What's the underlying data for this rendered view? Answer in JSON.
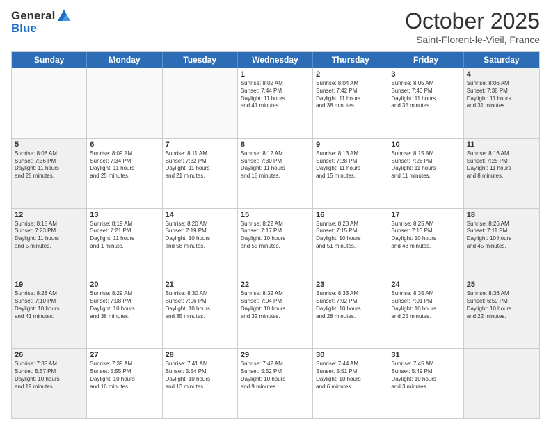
{
  "header": {
    "logo_general": "General",
    "logo_blue": "Blue",
    "month_title": "October 2025",
    "location": "Saint-Florent-le-Vieil, France"
  },
  "weekdays": [
    "Sunday",
    "Monday",
    "Tuesday",
    "Wednesday",
    "Thursday",
    "Friday",
    "Saturday"
  ],
  "rows": [
    [
      {
        "day": "",
        "text": "",
        "empty": true
      },
      {
        "day": "",
        "text": "",
        "empty": true
      },
      {
        "day": "",
        "text": "",
        "empty": true
      },
      {
        "day": "1",
        "text": "Sunrise: 8:02 AM\nSunset: 7:44 PM\nDaylight: 11 hours\nand 41 minutes.",
        "empty": false
      },
      {
        "day": "2",
        "text": "Sunrise: 8:04 AM\nSunset: 7:42 PM\nDaylight: 11 hours\nand 38 minutes.",
        "empty": false
      },
      {
        "day": "3",
        "text": "Sunrise: 8:05 AM\nSunset: 7:40 PM\nDaylight: 11 hours\nand 35 minutes.",
        "empty": false
      },
      {
        "day": "4",
        "text": "Sunrise: 8:06 AM\nSunset: 7:38 PM\nDaylight: 11 hours\nand 31 minutes.",
        "empty": false,
        "shaded": true
      }
    ],
    [
      {
        "day": "5",
        "text": "Sunrise: 8:08 AM\nSunset: 7:36 PM\nDaylight: 11 hours\nand 28 minutes.",
        "empty": false,
        "shaded": true
      },
      {
        "day": "6",
        "text": "Sunrise: 8:09 AM\nSunset: 7:34 PM\nDaylight: 11 hours\nand 25 minutes.",
        "empty": false
      },
      {
        "day": "7",
        "text": "Sunrise: 8:11 AM\nSunset: 7:32 PM\nDaylight: 11 hours\nand 21 minutes.",
        "empty": false
      },
      {
        "day": "8",
        "text": "Sunrise: 8:12 AM\nSunset: 7:30 PM\nDaylight: 11 hours\nand 18 minutes.",
        "empty": false
      },
      {
        "day": "9",
        "text": "Sunrise: 8:13 AM\nSunset: 7:28 PM\nDaylight: 11 hours\nand 15 minutes.",
        "empty": false
      },
      {
        "day": "10",
        "text": "Sunrise: 8:15 AM\nSunset: 7:26 PM\nDaylight: 11 hours\nand 11 minutes.",
        "empty": false
      },
      {
        "day": "11",
        "text": "Sunrise: 8:16 AM\nSunset: 7:25 PM\nDaylight: 11 hours\nand 8 minutes.",
        "empty": false,
        "shaded": true
      }
    ],
    [
      {
        "day": "12",
        "text": "Sunrise: 8:18 AM\nSunset: 7:23 PM\nDaylight: 11 hours\nand 5 minutes.",
        "empty": false,
        "shaded": true
      },
      {
        "day": "13",
        "text": "Sunrise: 8:19 AM\nSunset: 7:21 PM\nDaylight: 11 hours\nand 1 minute.",
        "empty": false
      },
      {
        "day": "14",
        "text": "Sunrise: 8:20 AM\nSunset: 7:19 PM\nDaylight: 10 hours\nand 58 minutes.",
        "empty": false
      },
      {
        "day": "15",
        "text": "Sunrise: 8:22 AM\nSunset: 7:17 PM\nDaylight: 10 hours\nand 55 minutes.",
        "empty": false
      },
      {
        "day": "16",
        "text": "Sunrise: 8:23 AM\nSunset: 7:15 PM\nDaylight: 10 hours\nand 51 minutes.",
        "empty": false
      },
      {
        "day": "17",
        "text": "Sunrise: 8:25 AM\nSunset: 7:13 PM\nDaylight: 10 hours\nand 48 minutes.",
        "empty": false
      },
      {
        "day": "18",
        "text": "Sunrise: 8:26 AM\nSunset: 7:11 PM\nDaylight: 10 hours\nand 45 minutes.",
        "empty": false,
        "shaded": true
      }
    ],
    [
      {
        "day": "19",
        "text": "Sunrise: 8:28 AM\nSunset: 7:10 PM\nDaylight: 10 hours\nand 41 minutes.",
        "empty": false,
        "shaded": true
      },
      {
        "day": "20",
        "text": "Sunrise: 8:29 AM\nSunset: 7:08 PM\nDaylight: 10 hours\nand 38 minutes.",
        "empty": false
      },
      {
        "day": "21",
        "text": "Sunrise: 8:30 AM\nSunset: 7:06 PM\nDaylight: 10 hours\nand 35 minutes.",
        "empty": false
      },
      {
        "day": "22",
        "text": "Sunrise: 8:32 AM\nSunset: 7:04 PM\nDaylight: 10 hours\nand 32 minutes.",
        "empty": false
      },
      {
        "day": "23",
        "text": "Sunrise: 8:33 AM\nSunset: 7:02 PM\nDaylight: 10 hours\nand 28 minutes.",
        "empty": false
      },
      {
        "day": "24",
        "text": "Sunrise: 8:35 AM\nSunset: 7:01 PM\nDaylight: 10 hours\nand 25 minutes.",
        "empty": false
      },
      {
        "day": "25",
        "text": "Sunrise: 8:36 AM\nSunset: 6:59 PM\nDaylight: 10 hours\nand 22 minutes.",
        "empty": false,
        "shaded": true
      }
    ],
    [
      {
        "day": "26",
        "text": "Sunrise: 7:38 AM\nSunset: 5:57 PM\nDaylight: 10 hours\nand 19 minutes.",
        "empty": false,
        "shaded": true
      },
      {
        "day": "27",
        "text": "Sunrise: 7:39 AM\nSunset: 5:55 PM\nDaylight: 10 hours\nand 16 minutes.",
        "empty": false
      },
      {
        "day": "28",
        "text": "Sunrise: 7:41 AM\nSunset: 5:54 PM\nDaylight: 10 hours\nand 13 minutes.",
        "empty": false
      },
      {
        "day": "29",
        "text": "Sunrise: 7:42 AM\nSunset: 5:52 PM\nDaylight: 10 hours\nand 9 minutes.",
        "empty": false
      },
      {
        "day": "30",
        "text": "Sunrise: 7:44 AM\nSunset: 5:51 PM\nDaylight: 10 hours\nand 6 minutes.",
        "empty": false
      },
      {
        "day": "31",
        "text": "Sunrise: 7:45 AM\nSunset: 5:49 PM\nDaylight: 10 hours\nand 3 minutes.",
        "empty": false
      },
      {
        "day": "",
        "text": "",
        "empty": true,
        "shaded": true
      }
    ]
  ]
}
